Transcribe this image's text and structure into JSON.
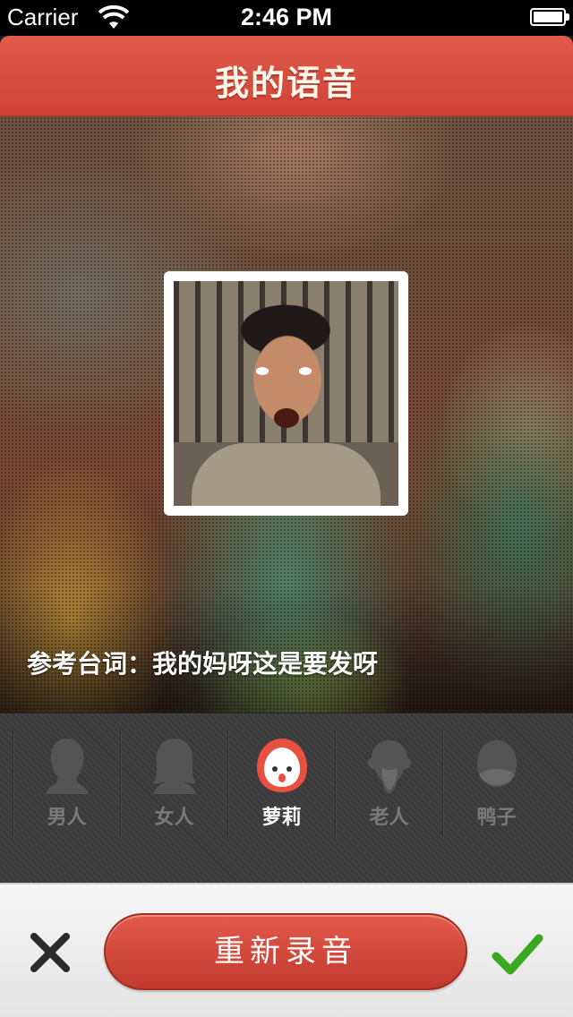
{
  "status_bar": {
    "carrier": "Carrier",
    "time": "2:46 PM"
  },
  "header": {
    "title": "我的语音"
  },
  "video": {
    "reference_line": "参考台词：我的妈呀这是要发呀"
  },
  "voices": [
    {
      "label": "男人",
      "icon": "man-silhouette-icon",
      "selected": false
    },
    {
      "label": "女人",
      "icon": "woman-silhouette-icon",
      "selected": false
    },
    {
      "label": "萝莉",
      "icon": "loli-face-icon",
      "selected": true
    },
    {
      "label": "老人",
      "icon": "old-man-icon",
      "selected": false
    },
    {
      "label": "鸭子",
      "icon": "duck-icon",
      "selected": false
    }
  ],
  "footer": {
    "cancel_icon": "close-icon",
    "rerecord_label": "重新录音",
    "confirm_icon": "checkmark-icon"
  },
  "colors": {
    "accent_red": "#d64a3c",
    "confirm_green": "#3aa81e",
    "voice_bar_bg": "#3b3a3b"
  }
}
